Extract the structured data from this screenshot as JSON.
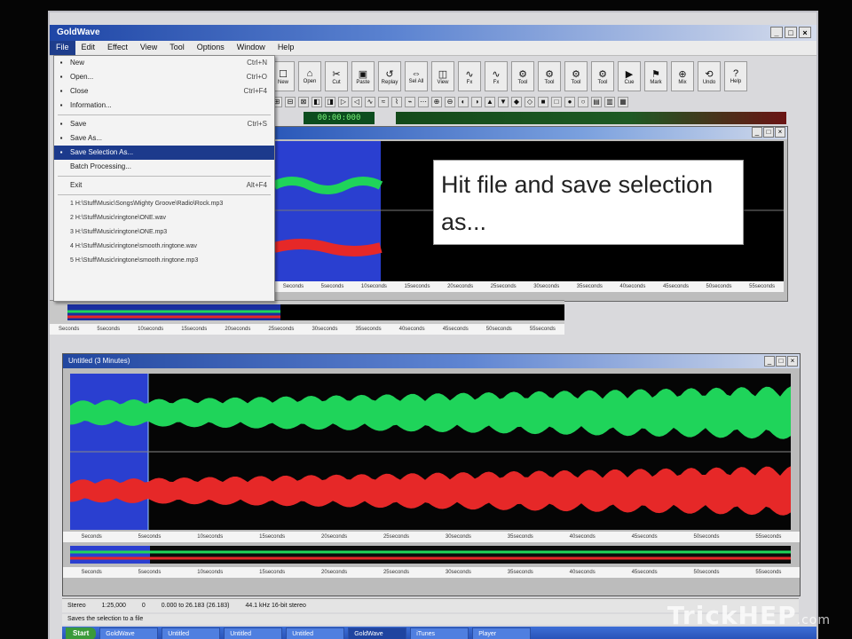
{
  "window": {
    "title": "GoldWave"
  },
  "menubar": [
    "File",
    "Edit",
    "Effect",
    "View",
    "Tool",
    "Options",
    "Window",
    "Help"
  ],
  "file_menu": [
    {
      "label": "New",
      "shortcut": "Ctrl+N",
      "icon": "new-doc-icon"
    },
    {
      "label": "Open...",
      "shortcut": "Ctrl+O",
      "icon": "open-folder-icon"
    },
    {
      "label": "Close",
      "shortcut": "Ctrl+F4",
      "icon": "close-icon"
    },
    {
      "label": "Information...",
      "shortcut": "",
      "icon": "info-icon"
    },
    {
      "sep": true
    },
    {
      "label": "Save",
      "shortcut": "Ctrl+S",
      "icon": "save-icon"
    },
    {
      "label": "Save As...",
      "shortcut": "",
      "icon": "save-as-icon"
    },
    {
      "label": "Save Selection As...",
      "shortcut": "",
      "icon": "save-selection-icon",
      "highlight": true
    },
    {
      "label": "Batch Processing...",
      "shortcut": "",
      "icon": ""
    },
    {
      "sep": true
    },
    {
      "label": "Exit",
      "shortcut": "Alt+F4",
      "icon": ""
    },
    {
      "sep": true
    },
    {
      "label": "1 H:\\Stuff\\Music\\Songs\\Mighty Groove\\Radio\\Rock.mp3",
      "shortcut": "",
      "icon": "",
      "recent": true
    },
    {
      "label": "2 H:\\Stuff\\Music\\ringtone\\ONE.wav",
      "shortcut": "",
      "icon": "",
      "recent": true
    },
    {
      "label": "3 H:\\Stuff\\Music\\ringtone\\ONE.mp3",
      "shortcut": "",
      "icon": "",
      "recent": true
    },
    {
      "label": "4 H:\\Stuff\\Music\\ringtone\\smooth.ringtone.wav",
      "shortcut": "",
      "icon": "",
      "recent": true
    },
    {
      "label": "5 H:\\Stuff\\Music\\ringtone\\smooth.ringtone.mp3",
      "shortcut": "",
      "icon": "",
      "recent": true
    }
  ],
  "toolbar_large": [
    {
      "name": "new",
      "glyph": "☐",
      "label": "New"
    },
    {
      "name": "open",
      "glyph": "⌂",
      "label": "Open"
    },
    {
      "name": "cut",
      "glyph": "✂",
      "label": "Cut"
    },
    {
      "name": "paste",
      "glyph": "▣",
      "label": "Paste"
    },
    {
      "name": "replay",
      "glyph": "↺",
      "label": "Replay"
    },
    {
      "name": "select-all",
      "glyph": "⇔",
      "label": "Sel All"
    },
    {
      "name": "view",
      "glyph": "◫",
      "label": "View"
    },
    {
      "name": "fx1",
      "glyph": "∿",
      "label": "Fx"
    },
    {
      "name": "fx2",
      "glyph": "∿",
      "label": "Fx"
    },
    {
      "name": "fx3",
      "glyph": "⚙",
      "label": "Tool"
    },
    {
      "name": "fx4",
      "glyph": "⚙",
      "label": "Tool"
    },
    {
      "name": "fx5",
      "glyph": "⚙",
      "label": "Tool"
    },
    {
      "name": "fx6",
      "glyph": "⚙",
      "label": "Tool"
    },
    {
      "name": "cue",
      "glyph": "▶",
      "label": "Cue"
    },
    {
      "name": "mark",
      "glyph": "⚑",
      "label": "Mark"
    },
    {
      "name": "mix",
      "glyph": "⊕",
      "label": "Mix"
    },
    {
      "name": "undo",
      "glyph": "⟲",
      "label": "Undo"
    },
    {
      "name": "help",
      "glyph": "?",
      "label": "Help"
    }
  ],
  "toolbar_small": [
    "⊞",
    "⊟",
    "⊠",
    "◧",
    "◨",
    "▷",
    "◁",
    "∿",
    "≈",
    "⌇",
    "⌁",
    "⋯",
    "⊕",
    "⊖",
    "◐",
    "◑",
    "▲",
    "▼",
    "◆",
    "◇",
    "■",
    "□",
    "●",
    "○",
    "▤",
    "▥",
    "▦"
  ],
  "time_display": "00:00:000",
  "ruler_labels": [
    "Seconds",
    "5seconds",
    "10seconds",
    "15seconds",
    "20seconds",
    "25seconds",
    "30seconds",
    "35seconds",
    "40seconds",
    "45seconds",
    "50seconds",
    "55seconds"
  ],
  "callout": {
    "text": "Hit file and save selection as..."
  },
  "main_window": {
    "title": "Untitled (3 Minutes)"
  },
  "statusbar": {
    "channels": "Stereo",
    "zoom": "1:25,000",
    "counter": "0",
    "selection": "0.000 to 26.183 (26.183)",
    "format": "44.1 kHz 16-bit stereo",
    "hint": "Saves the selection to a file"
  },
  "taskbar": {
    "start": "Start",
    "tasks": [
      "GoldWave",
      "Untitled",
      "Untitled",
      "Untitled",
      "GoldWave",
      "iTunes",
      "Player"
    ]
  },
  "watermark": {
    "brand": "TrickHEP",
    "suffix": ".com"
  },
  "colors": {
    "left_channel": "#1fd45a",
    "right_channel": "#e62828",
    "selection": "#2a3fd0",
    "titlebar": "#1f46a6"
  }
}
